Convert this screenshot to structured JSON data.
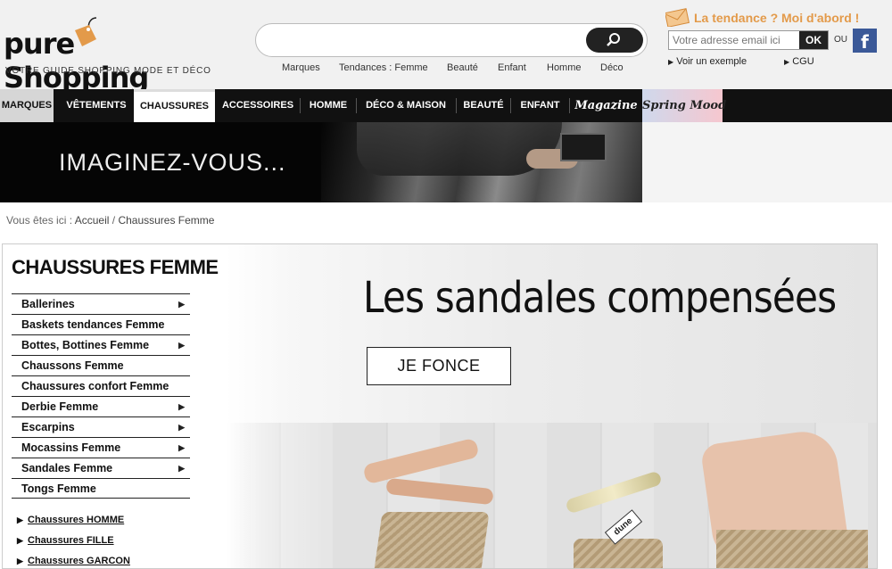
{
  "header": {
    "logo_text": "pure Shopping",
    "logo_tagline": "VOTRE GUIDE SHOPPING MODE ET DÉCO",
    "search_placeholder": "",
    "subnav": [
      "Marques",
      "Tendances : Femme",
      "Beauté",
      "Enfant",
      "Homme",
      "Déco"
    ],
    "newsletter": {
      "headline": "La tendance ? Moi d'abord !",
      "email_placeholder": "Votre adresse email ici",
      "ok_label": "OK",
      "ou_label": "OU",
      "facebook_label": "f",
      "voir_label": "Voir un exemple",
      "cgu_label": "CGU"
    }
  },
  "mainnav": {
    "items": [
      "MARQUES",
      "VÊTEMENTS",
      "CHAUSSURES",
      "ACCESSOIRES",
      "HOMME",
      "DÉCO & MAISON",
      "BEAUTÉ",
      "ENFANT",
      "Magazine",
      "Spring Mood"
    ],
    "active": "CHAUSSURES"
  },
  "banner": {
    "text": "IMAGINEZ-VOUS..."
  },
  "breadcrumb": {
    "prefix": "Vous êtes ici :",
    "items": [
      "Accueil",
      "Chaussures Femme"
    ],
    "separator": "/"
  },
  "sidebar": {
    "title": "CHAUSSURES FEMME",
    "items": [
      {
        "label": "Ballerines",
        "has_arrow": true
      },
      {
        "label": "Baskets tendances Femme",
        "has_arrow": false
      },
      {
        "label": "Bottes, Bottines Femme",
        "has_arrow": true
      },
      {
        "label": "Chaussons Femme",
        "has_arrow": false
      },
      {
        "label": "Chaussures confort Femme",
        "has_arrow": false
      },
      {
        "label": "Derbie Femme",
        "has_arrow": true
      },
      {
        "label": "Escarpins",
        "has_arrow": true
      },
      {
        "label": "Mocassins Femme",
        "has_arrow": true
      },
      {
        "label": "Sandales Femme",
        "has_arrow": true
      },
      {
        "label": "Tongs Femme",
        "has_arrow": false
      }
    ],
    "sub_links": [
      "Chaussures HOMME",
      "Chaussures FILLE",
      "Chaussures GARCON"
    ]
  },
  "promo": {
    "title": "Les sandales compensées",
    "button_label": "JE FONCE",
    "shoe_tag": "dune"
  },
  "colors": {
    "accent_orange": "#e39a4a",
    "nav_bg": "#111111",
    "facebook_blue": "#3b5998"
  },
  "icons": {
    "search": "search-icon",
    "envelope": "envelope-icon",
    "facebook": "facebook-icon",
    "arrow": "arrow-right-icon"
  }
}
